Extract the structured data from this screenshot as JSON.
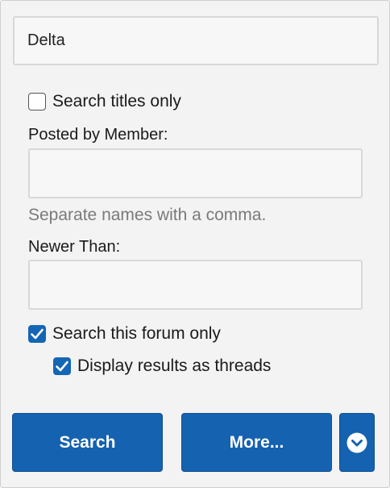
{
  "search": {
    "keywords_value": "Delta"
  },
  "options": {
    "titles_only": {
      "label": "Search titles only",
      "checked": false
    },
    "posted_by": {
      "label": "Posted by Member:",
      "value": "",
      "hint": "Separate names with a comma."
    },
    "newer_than": {
      "label": "Newer Than:",
      "value": ""
    },
    "this_forum_only": {
      "label": "Search this forum only",
      "checked": true
    },
    "display_as_threads": {
      "label": "Display results as threads",
      "checked": true
    }
  },
  "buttons": {
    "search_label": "Search",
    "more_label": "More...",
    "toggle_icon": "chevron-down-circle-icon"
  },
  "colors": {
    "accent": "#1562b0",
    "panel_bg": "#f3f3f3",
    "hint_text": "#7a7a7a"
  }
}
